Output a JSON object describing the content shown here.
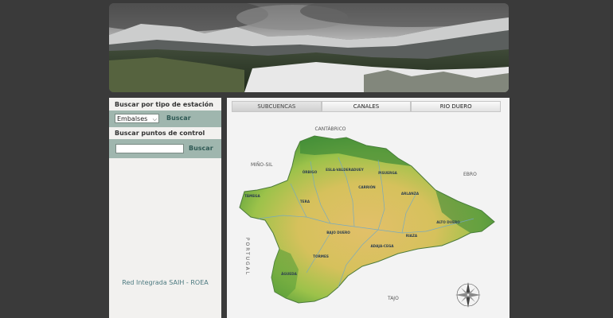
{
  "sidebar": {
    "station_search_title": "Buscar por tipo de estación",
    "station_type_selected": "Embalses",
    "station_search_button": "Buscar",
    "control_search_title": "Buscar puntos de control",
    "control_search_value": "",
    "control_search_button": "Buscar",
    "footer": "Red Integrada SAIH - ROEA"
  },
  "tabs": [
    {
      "label": "SUBCUENCAS",
      "active": true
    },
    {
      "label": "CANALES",
      "active": false
    },
    {
      "label": "RIO DUERO",
      "active": false
    }
  ],
  "map": {
    "outer_labels": {
      "north": "CANTÁBRICO",
      "northwest": "MIÑO-SIL",
      "east": "EBRO",
      "south": "TAJO",
      "west": "PORTUGAL"
    },
    "subbasins": [
      "ÓRBIGO",
      "ESLA-VALDERADUEY",
      "PISUERGA",
      "CARRIÓN",
      "ARLANZA",
      "TÁMEGA",
      "TERA",
      "ALTO DUERO",
      "BAJO DUERO",
      "RIAZA",
      "ADAJA-CEGA",
      "TORMES",
      "ÁGUEDA"
    ]
  },
  "colors": {
    "page_bg": "#3a3a3a",
    "sidebar_bg": "#f2f1ef",
    "sidebar_row": "#9fb6ae",
    "button_text": "#2f5a55",
    "footer_text": "#4d7a80",
    "main_bg": "#f3f3f3"
  }
}
